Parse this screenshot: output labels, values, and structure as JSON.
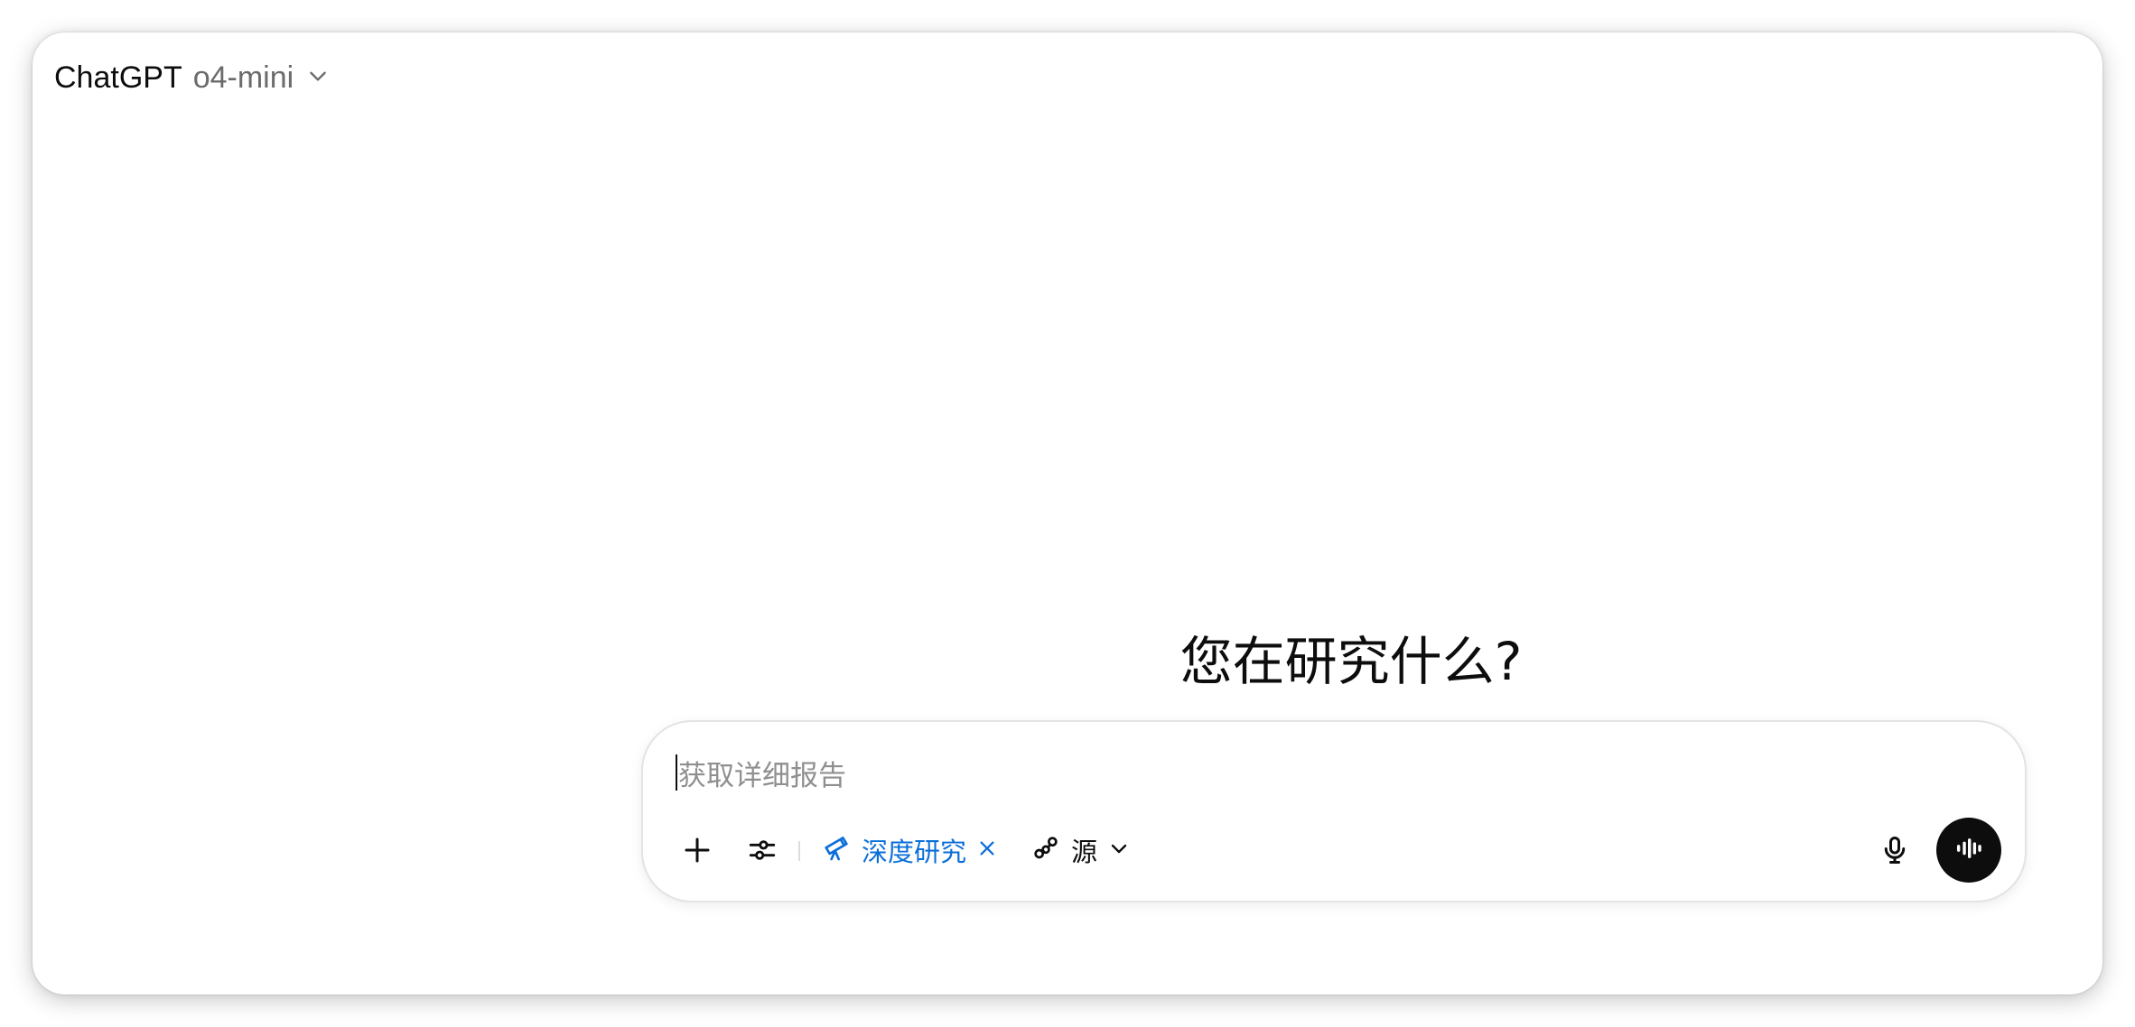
{
  "header": {
    "app_name": "ChatGPT",
    "model_name": "o4-mini",
    "model_menu_icon": "chevron-down-icon"
  },
  "main": {
    "heading": "您在研究什么?"
  },
  "composer": {
    "placeholder": "获取详细报告",
    "input_value": "",
    "tools": {
      "add_icon": "plus-icon",
      "tools_icon": "sliders-icon",
      "mode_chip": {
        "icon": "telescope-icon",
        "label": "深度研究",
        "remove_icon": "close-icon",
        "color": "#0a6ed8"
      },
      "sources": {
        "icon": "link-icon",
        "label": "源",
        "menu_icon": "chevron-down-icon"
      },
      "mic_icon": "microphone-icon",
      "voice_icon": "voice-waveform-icon"
    }
  },
  "colors": {
    "text": "#0d0d0d",
    "muted": "#6b6b6b",
    "placeholder": "#8f8f8f",
    "accent": "#0a6ed8",
    "voice_button_bg": "#0d0d0d"
  }
}
